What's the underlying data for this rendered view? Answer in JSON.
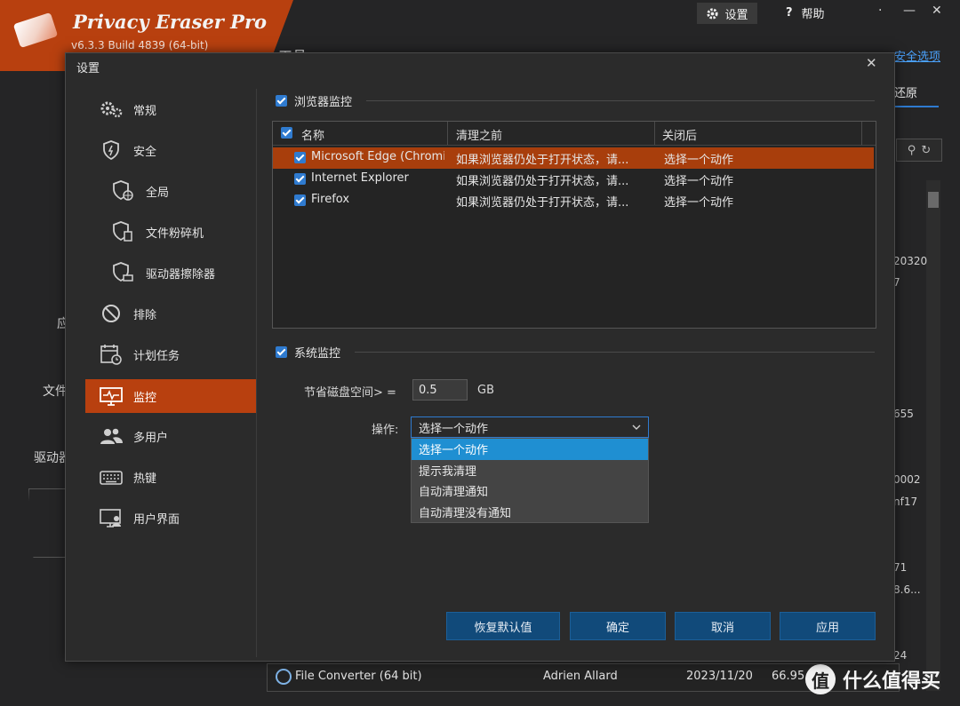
{
  "app": {
    "title": "Privacy Eraser Pro",
    "version": "v6.3.3 Build 4839 (64-bit)",
    "top_settings_label": "设置",
    "top_help_label": "帮助",
    "page_title": "工具",
    "security_link": "安全选项",
    "restore_tab": "还原",
    "left_fragments": [
      "应",
      "文件",
      "驱动器"
    ],
    "right_fragments": [
      "20320",
      "7",
      "655",
      "0002",
      "nf17",
      "71",
      "8.6...",
      "24"
    ],
    "bottom_row": {
      "name": "File Converter (64 bit)",
      "publisher": "Adrien Allard",
      "date": "2023/11/20",
      "size": "66.95"
    },
    "watermark": {
      "logo": "值",
      "text": "什么值得买"
    }
  },
  "dialog": {
    "title": "设置",
    "close_glyph": "✕",
    "nav": [
      {
        "label": "常规",
        "icon": "gears-icon"
      },
      {
        "label": "安全",
        "icon": "shield-icon"
      },
      {
        "label": "全局",
        "icon": "shield-globe-icon"
      },
      {
        "label": "文件粉碎机",
        "icon": "shield-file-icon"
      },
      {
        "label": "驱动器擦除器",
        "icon": "shield-drive-icon"
      },
      {
        "label": "排除",
        "icon": "block-icon"
      },
      {
        "label": "计划任务",
        "icon": "calendar-icon"
      },
      {
        "label": "监控",
        "icon": "monitor-icon",
        "active": true
      },
      {
        "label": "多用户",
        "icon": "users-icon"
      },
      {
        "label": "热键",
        "icon": "keyboard-icon"
      },
      {
        "label": "用户界面",
        "icon": "user-screen-icon"
      }
    ],
    "browser_monitor": {
      "label": "浏览器监控",
      "checked": true,
      "columns": [
        "名称",
        "清理之前",
        "关闭后"
      ],
      "rows": [
        {
          "name": "Microsoft Edge (Chromi...",
          "before": "如果浏览器仍处于打开状态，请...",
          "after": "选择一个动作",
          "selected": true
        },
        {
          "name": "Internet Explorer",
          "before": "如果浏览器仍处于打开状态，请...",
          "after": "选择一个动作"
        },
        {
          "name": "Firefox",
          "before": "如果浏览器仍处于打开状态，请...",
          "after": "选择一个动作"
        }
      ]
    },
    "system_monitor": {
      "label": "系统监控",
      "checked": true,
      "disk_label": "节省磁盘空间> =",
      "disk_value": "0.5",
      "disk_unit": "GB",
      "op_label": "操作:",
      "op_selected": "选择一个动作",
      "op_options": [
        "选择一个动作",
        "提示我清理",
        "自动清理通知",
        "自动清理没有通知"
      ]
    },
    "buttons": {
      "restore_defaults": "恢复默认值",
      "ok": "确定",
      "cancel": "取消",
      "apply": "应用"
    }
  },
  "colors": {
    "accent_orange": "#b8400f",
    "accent_blue": "#2f7bd0",
    "highlight_blue": "#1f8fd2",
    "button_blue": "#114a7a"
  }
}
